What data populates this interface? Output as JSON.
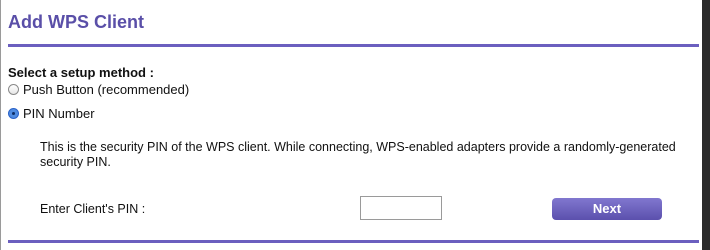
{
  "page": {
    "title": "Add WPS Client"
  },
  "setup": {
    "label": "Select a setup method :",
    "options": [
      {
        "label": "Push Button (recommended)",
        "selected": false
      },
      {
        "label": "PIN Number",
        "selected": true
      }
    ]
  },
  "pin_section": {
    "description": "This is the security PIN of the WPS client. While connecting, WPS-enabled adapters provide a randomly-generated security PIN.",
    "input_label": "Enter Client's PIN :",
    "input_value": ""
  },
  "actions": {
    "next_label": "Next"
  },
  "colors": {
    "accent": "#5a4fa8",
    "rule": "#6b5fbf",
    "button": "#6a60bd"
  }
}
